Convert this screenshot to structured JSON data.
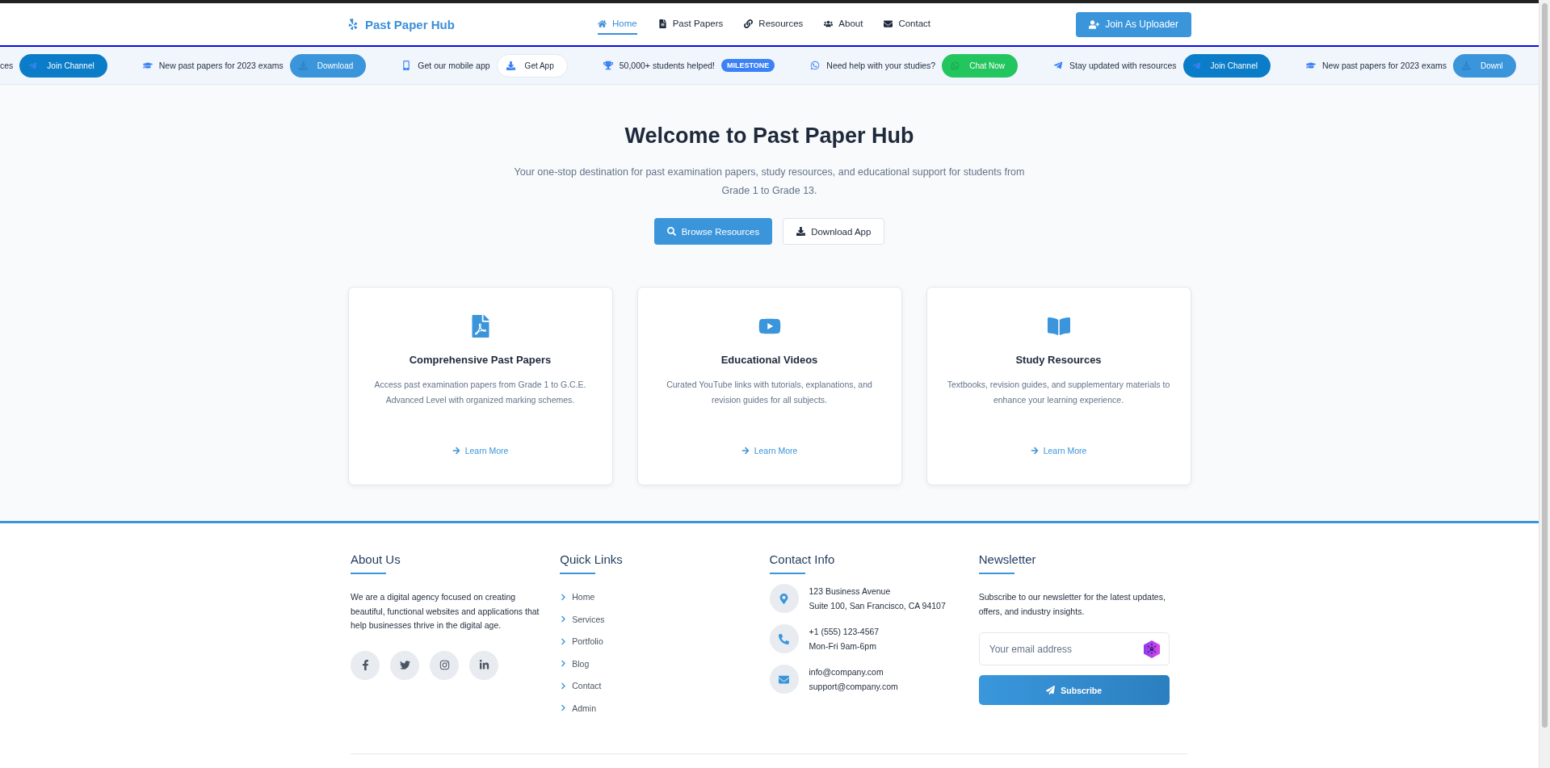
{
  "header": {
    "logo": "Past Paper Hub",
    "nav": [
      {
        "label": "Home",
        "selected": true
      },
      {
        "label": "Past Papers",
        "selected": false
      },
      {
        "label": "Resources",
        "selected": false
      },
      {
        "label": "About",
        "selected": false
      },
      {
        "label": "Contact",
        "selected": false
      }
    ],
    "cta": "Join As Uploader"
  },
  "ticker": [
    {
      "kind": "channel",
      "cut": true,
      "text": "ces",
      "button": "Join Channel"
    },
    {
      "kind": "download",
      "cut": false,
      "text": "New past papers for 2023 exams",
      "button": "Download"
    },
    {
      "kind": "app",
      "cut": false,
      "text": "Get our mobile app",
      "button": "Get App"
    },
    {
      "kind": "badge",
      "cut": false,
      "text": "50,000+ students helped!",
      "button": "MILESTONE"
    },
    {
      "kind": "chat",
      "cut": false,
      "text": "Need help with your studies?",
      "button": "Chat Now"
    },
    {
      "kind": "channel",
      "cut": false,
      "text": "Stay updated with resources",
      "button": "Join Channel"
    },
    {
      "kind": "download",
      "cut": false,
      "text": "New past papers for 2023 exams",
      "button": "Downl"
    }
  ],
  "hero": {
    "title": "Welcome to Past Paper Hub",
    "subtitle": "Your one-stop destination for past examination papers, study resources, and educational support for students from Grade 1 to Grade 13.",
    "primary": "Browse Resources",
    "secondary": "Download App"
  },
  "features": [
    {
      "title": "Comprehensive Past Papers",
      "text": "Access past examination papers from Grade 1 to G.C.E. Advanced Level with organized marking schemes.",
      "link": "Learn More"
    },
    {
      "title": "Educational Videos",
      "text": "Curated YouTube links with tutorials, explanations, and revision guides for all subjects.",
      "link": "Learn More"
    },
    {
      "title": "Study Resources",
      "text": "Textbooks, revision guides, and supplementary materials to enhance your learning experience.",
      "link": "Learn More"
    }
  ],
  "footer": {
    "about": {
      "title": "About Us",
      "text": "We are a digital agency focused on creating beautiful, functional websites and applications that help businesses thrive in the digital age."
    },
    "quick_links": {
      "title": "Quick Links",
      "items": [
        "Home",
        "Services",
        "Portfolio",
        "Blog",
        "Contact",
        "Admin"
      ]
    },
    "contact": {
      "title": "Contact Info",
      "items": [
        {
          "lines": [
            "123 Business Avenue",
            "Suite 100, San Francisco, CA 94107"
          ]
        },
        {
          "lines": [
            "+1 (555) 123-4567",
            "Mon-Fri 9am-6pm"
          ]
        },
        {
          "lines": [
            "info@company.com",
            "support@company.com"
          ]
        }
      ]
    },
    "newsletter": {
      "title": "Newsletter",
      "text": "Subscribe to our newsletter for the latest updates, offers, and industry insights.",
      "placeholder": "Your email address",
      "button": "Subscribe"
    }
  }
}
